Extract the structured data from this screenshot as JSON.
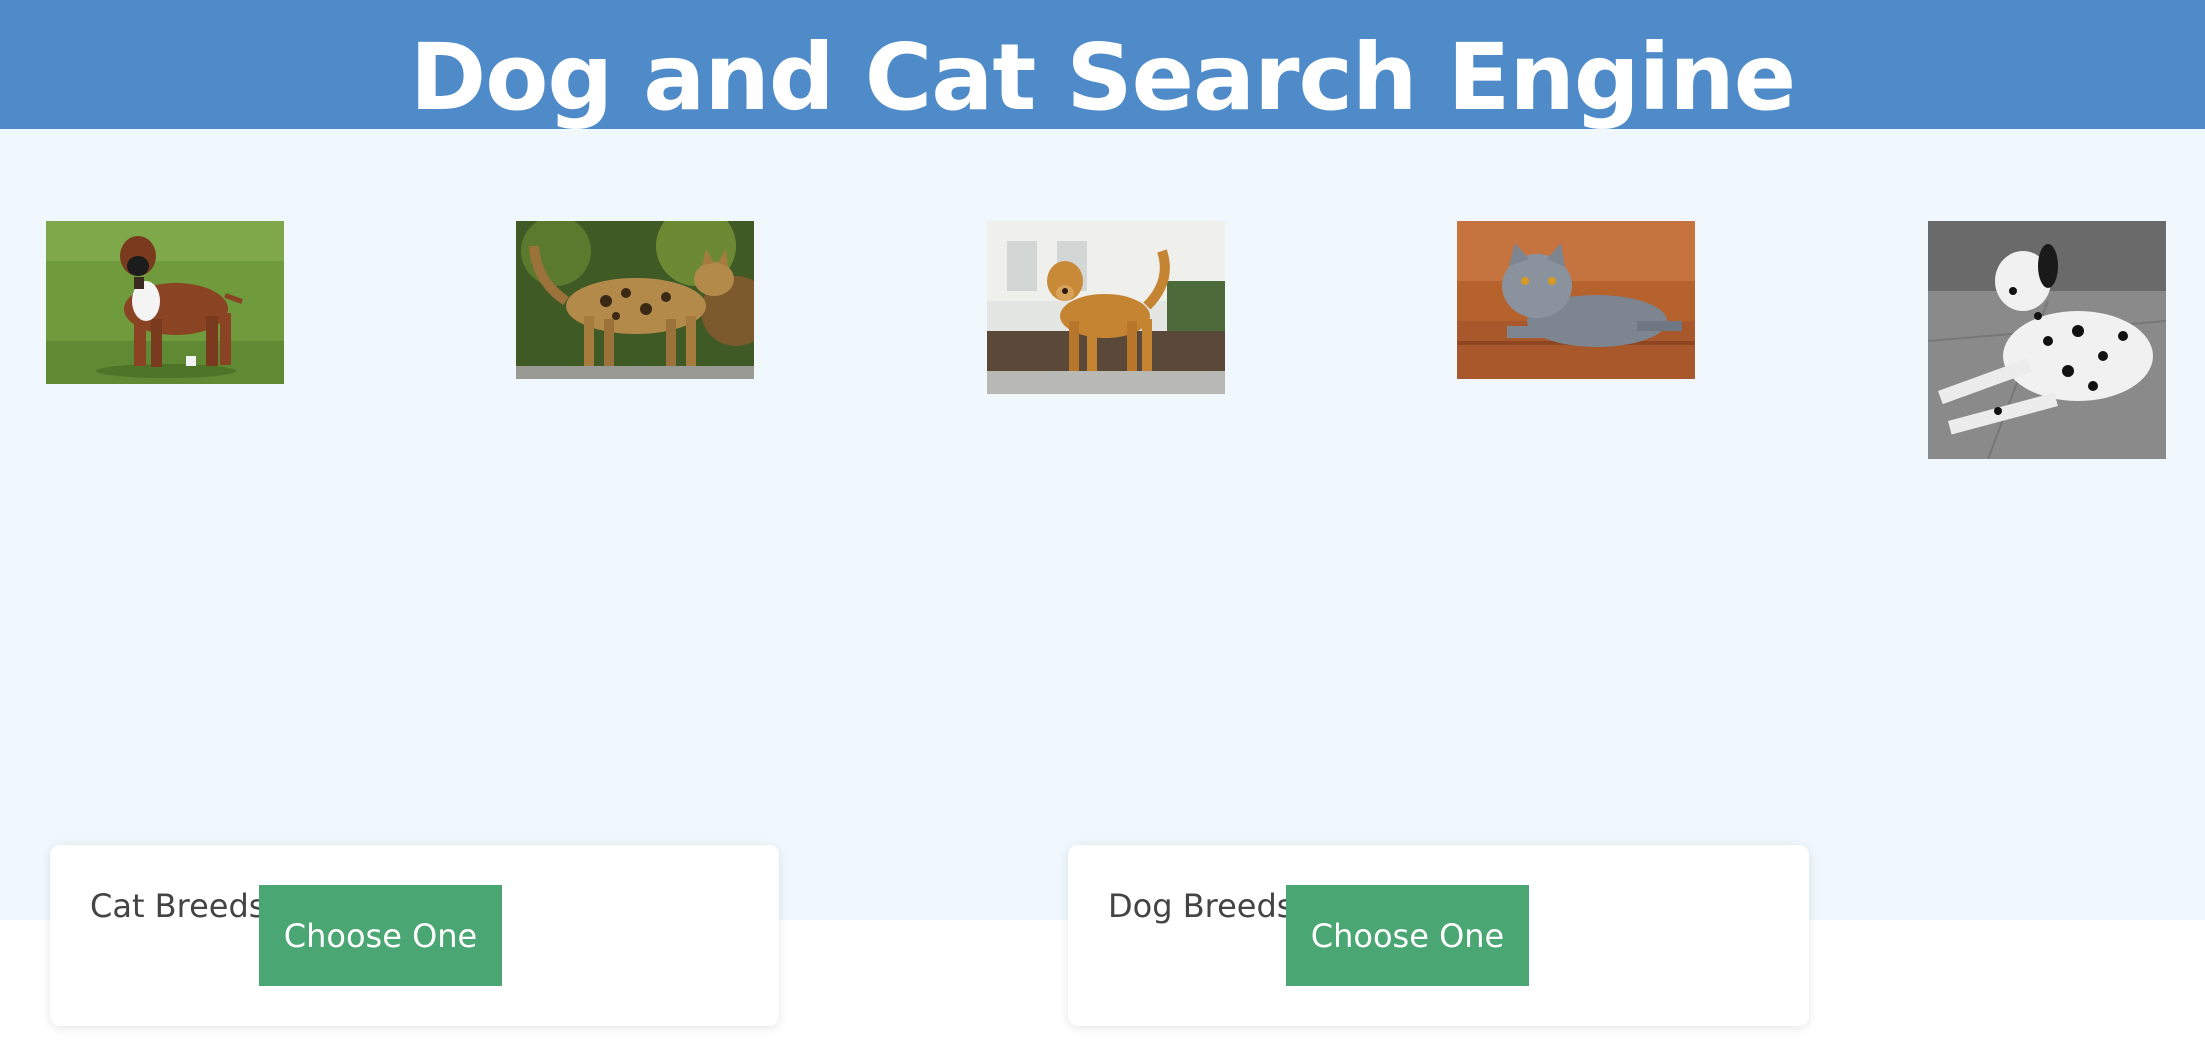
{
  "header": {
    "title": "Dog and Cat Search Engine",
    "background": "#4f8bc9"
  },
  "gallery": [
    {
      "name": "boxer-dog-image",
      "icon": "boxer-dog-photo"
    },
    {
      "name": "bengal-cat-image",
      "icon": "bengal-cat-photo"
    },
    {
      "name": "golden-retriever-image",
      "icon": "golden-retriever-photo"
    },
    {
      "name": "british-shorthair-image",
      "icon": "british-shorthair-photo"
    },
    {
      "name": "dalmatian-image",
      "icon": "dalmatian-photo"
    }
  ],
  "cat_panel": {
    "label": "Cat Breeds",
    "button_label": "Choose One"
  },
  "dog_panel": {
    "label": "Dog Breeds",
    "button_label": "Choose One"
  },
  "colors": {
    "hero_background": "#f0f7fd",
    "button": "#4aa672"
  }
}
